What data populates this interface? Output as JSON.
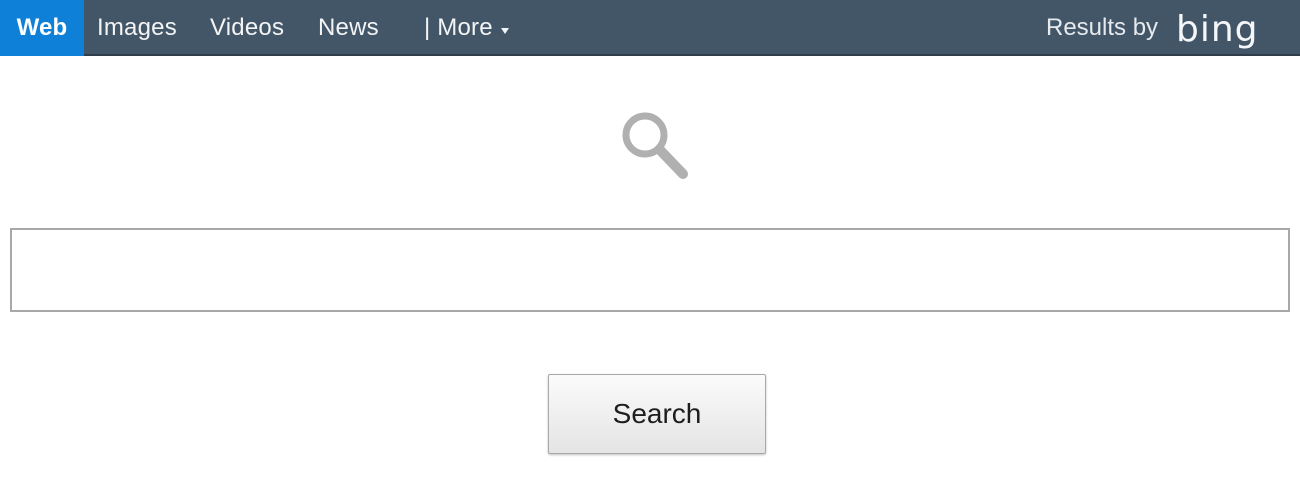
{
  "nav": {
    "tabs": [
      {
        "label": "Web",
        "active": true
      },
      {
        "label": "Images"
      },
      {
        "label": "Videos"
      },
      {
        "label": "News"
      }
    ],
    "more_label": "| More",
    "results_by": "Results by",
    "brand": "bing"
  },
  "search": {
    "value": "",
    "placeholder": "",
    "button_label": "Search"
  },
  "colors": {
    "topbar": "#435668",
    "active_tab": "#0e80d8",
    "icon": "#b0b0b0"
  }
}
